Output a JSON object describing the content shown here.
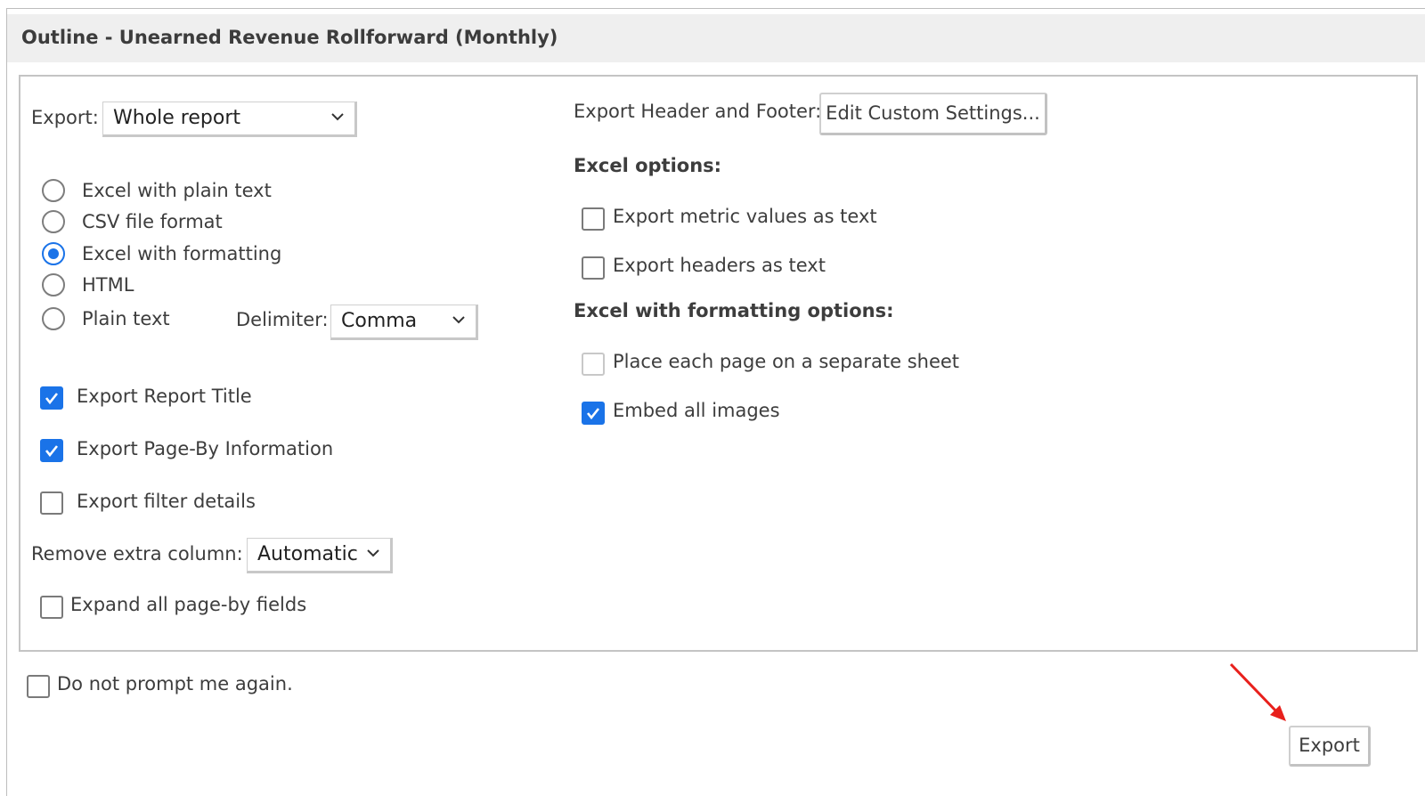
{
  "dialog": {
    "title": "Outline - Unearned Revenue Rollforward (Monthly)"
  },
  "export_select": {
    "label": "Export:",
    "value": "Whole report"
  },
  "formats": [
    {
      "label": "Excel with plain text",
      "selected": false
    },
    {
      "label": "CSV file format",
      "selected": false
    },
    {
      "label": "Excel with formatting",
      "selected": true
    },
    {
      "label": "HTML",
      "selected": false
    },
    {
      "label": "Plain text",
      "selected": false
    }
  ],
  "delimiter": {
    "label": "Delimiter:",
    "value": "Comma"
  },
  "options_left": [
    {
      "label": "Export Report Title",
      "checked": true
    },
    {
      "label": "Export Page-By Information",
      "checked": true
    },
    {
      "label": "Export filter details",
      "checked": false
    }
  ],
  "remove_extra_column": {
    "label": "Remove extra column:",
    "value": "Automatic"
  },
  "expand_pageby": {
    "label": "Expand all page-by fields",
    "checked": false
  },
  "header_footer": {
    "label": "Export Header and Footer:",
    "button": "Edit Custom Settings..."
  },
  "excel_options": {
    "heading": "Excel options:",
    "items": [
      {
        "label": "Export metric values as text",
        "checked": false
      },
      {
        "label": "Export headers as text",
        "checked": false
      }
    ]
  },
  "formatting_options": {
    "heading": "Excel with formatting options:",
    "items": [
      {
        "label": "Place each page on a separate sheet",
        "checked": false,
        "disabled": true
      },
      {
        "label": "Embed all images",
        "checked": true
      }
    ]
  },
  "do_not_prompt": {
    "label": "Do not prompt me again.",
    "checked": false
  },
  "export_button": {
    "label": "Export"
  },
  "colors": {
    "accent": "#1a73e8",
    "annotation_arrow": "#e8201c"
  }
}
